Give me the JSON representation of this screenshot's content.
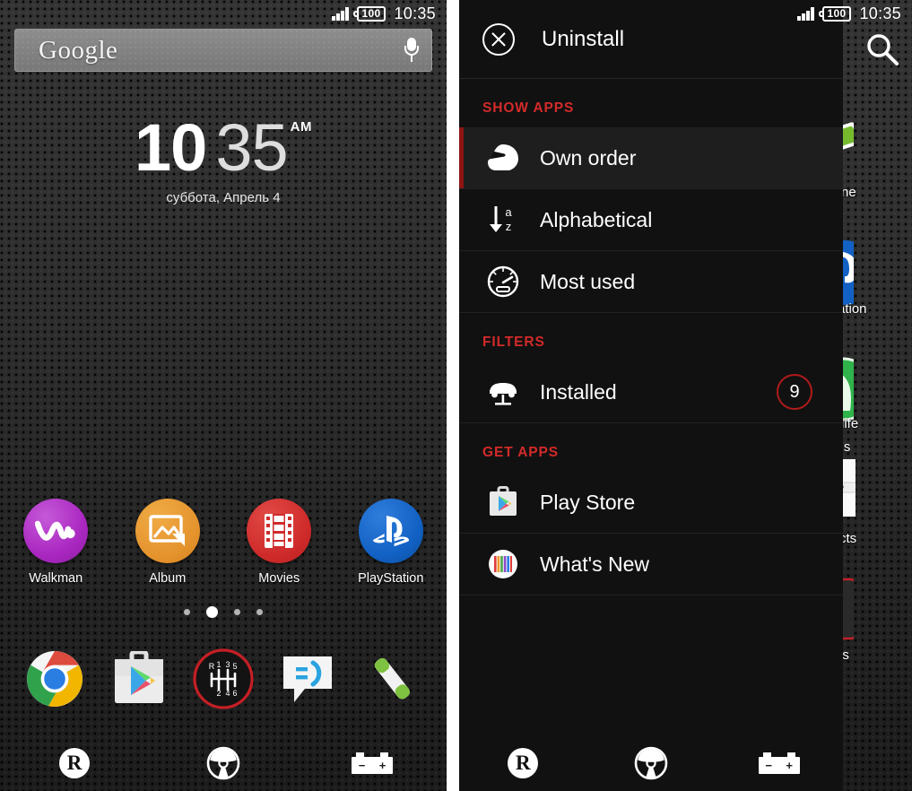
{
  "left_screen": {
    "status_bar": {
      "battery": "100",
      "time": "10:35",
      "signal_icon": "signal-bars-icon"
    },
    "search_widget": {
      "brand": "Google",
      "placeholder": "Google",
      "mic_icon": "microphone-icon"
    },
    "clock_widget": {
      "hours": "10",
      "minutes": "35",
      "meridiem": "AM",
      "date": "суббота, Апрель 4"
    },
    "apps": [
      {
        "label": "Walkman",
        "icon": "walkman-icon",
        "color": "#a927c0"
      },
      {
        "label": "Album",
        "icon": "album-icon",
        "color": "#e5942e"
      },
      {
        "label": "Movies",
        "icon": "movies-icon",
        "color": "#cf2b2b"
      },
      {
        "label": "PlayStation",
        "icon": "playstation-icon",
        "color": "#1261c4"
      }
    ],
    "page_indicator": {
      "count": 4,
      "active_index": 1
    },
    "dock": [
      {
        "name": "Chrome",
        "icon": "chrome-icon"
      },
      {
        "name": "Play Store",
        "icon": "play-store-icon"
      },
      {
        "name": "App drawer",
        "icon": "gear-shifter-icon"
      },
      {
        "name": "Messaging",
        "icon": "messaging-icon"
      },
      {
        "name": "Phone",
        "icon": "phone-handset-icon"
      }
    ],
    "nav_bar": [
      {
        "name": "Back",
        "icon": "reverse-r-icon",
        "glyph": "R"
      },
      {
        "name": "Home",
        "icon": "steering-wheel-icon"
      },
      {
        "name": "Recents",
        "icon": "car-battery-icon",
        "minus": "−",
        "plus": "+"
      }
    ]
  },
  "right_screen": {
    "status_bar": {
      "battery": "100",
      "time": "10:35",
      "signal_icon": "signal-bars-icon"
    },
    "drawer": {
      "header": {
        "label": "Uninstall",
        "icon": "circle-x-icon"
      },
      "sections": [
        {
          "title": "SHOW APPS",
          "items": [
            {
              "label": "Own order",
              "icon": "racing-helmet-icon",
              "selected": true,
              "badge": null
            },
            {
              "label": "Alphabetical",
              "icon": "sort-a-z-icon",
              "selected": false,
              "badge": null
            },
            {
              "label": "Most used",
              "icon": "speedometer-icon",
              "selected": false,
              "badge": null
            }
          ]
        },
        {
          "title": "FILTERS",
          "items": [
            {
              "label": "Installed",
              "icon": "car-on-lift-icon",
              "selected": false,
              "badge": "9"
            }
          ]
        },
        {
          "title": "GET APPS",
          "items": [
            {
              "label": "Play Store",
              "icon": "play-store-icon",
              "selected": false,
              "badge": null
            },
            {
              "label": "What's New",
              "icon": "whats-new-icon",
              "selected": false,
              "badge": null
            }
          ]
        }
      ]
    },
    "behind_strip": {
      "search_icon": "search-icon",
      "partial_labels": [
        "ne",
        "ation",
        "life",
        "'s",
        "cts",
        "ls"
      ]
    },
    "nav_bar": [
      {
        "name": "Back",
        "icon": "reverse-r-icon",
        "glyph": "R"
      },
      {
        "name": "Home",
        "icon": "steering-wheel-icon"
      },
      {
        "name": "Recents",
        "icon": "car-battery-icon",
        "minus": "−",
        "plus": "+"
      }
    ]
  },
  "theme": {
    "accent_red": "#d32a2a",
    "selected_bar": "#8e1414",
    "drawer_bg": "#111111",
    "text": "#ffffff"
  }
}
